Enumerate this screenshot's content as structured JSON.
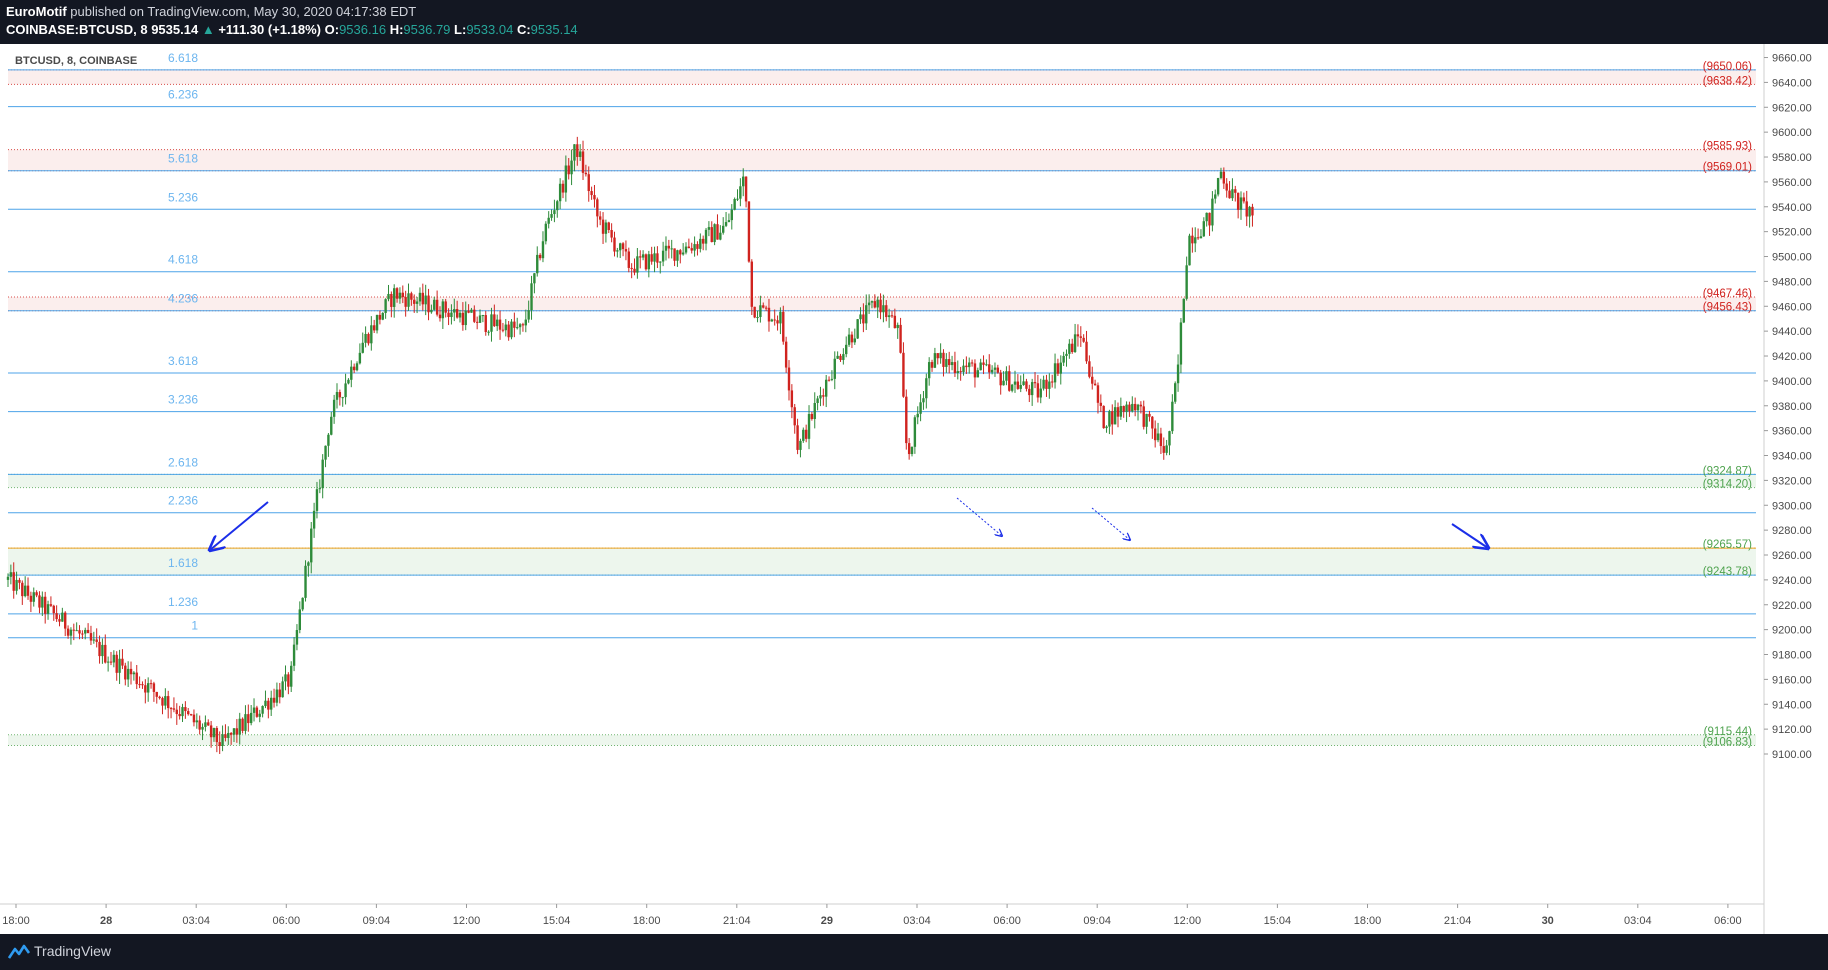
{
  "header": {
    "author": "EuroMotif",
    "published_text": "published on TradingView.com, May 30, 2020 04:17:38 EDT",
    "symbol_line": "COINBASE:BTCUSD, 8",
    "last_price": "9535.14",
    "change_arrow": "▲",
    "change": "+111.30 (+1.18%)",
    "o_label": "O:",
    "o_value": "9536.16",
    "h_label": "H:",
    "h_value": "9536.79",
    "l_label": "L:",
    "l_value": "9533.04",
    "c_label": "C:",
    "c_value": "9535.14"
  },
  "chart_title": "BTCUSD, 8, COINBASE",
  "footer": {
    "brand": "TradingView"
  },
  "colors": {
    "up": "#2e8b3a",
    "down": "#d0231f",
    "fib": "#4da3e8",
    "fib_label": "#6cb5ef",
    "resistance": "#d0231f",
    "support": "#4fa34f",
    "orange": "#f0a020",
    "arrow": "#1b2ee8"
  },
  "chart_data": {
    "type": "candlestick",
    "ylim": [
      9088,
      9670
    ],
    "y_ticks": [
      9100,
      9120,
      9140,
      9160,
      9180,
      9200,
      9220,
      9240,
      9260,
      9280,
      9300,
      9320,
      9340,
      9360,
      9380,
      9400,
      9420,
      9440,
      9460,
      9480,
      9500,
      9520,
      9540,
      9560,
      9580,
      9600,
      9620,
      9640,
      9660
    ],
    "x_ticks": [
      {
        "label": "18:00",
        "bold": false
      },
      {
        "label": "28",
        "bold": true
      },
      {
        "label": "03:04",
        "bold": false
      },
      {
        "label": "06:00",
        "bold": false
      },
      {
        "label": "09:04",
        "bold": false
      },
      {
        "label": "12:00",
        "bold": false
      },
      {
        "label": "15:04",
        "bold": false
      },
      {
        "label": "18:00",
        "bold": false
      },
      {
        "label": "21:04",
        "bold": false
      },
      {
        "label": "29",
        "bold": true
      },
      {
        "label": "03:04",
        "bold": false
      },
      {
        "label": "06:00",
        "bold": false
      },
      {
        "label": "09:04",
        "bold": false
      },
      {
        "label": "12:00",
        "bold": false
      },
      {
        "label": "15:04",
        "bold": false
      },
      {
        "label": "18:00",
        "bold": false
      },
      {
        "label": "21:04",
        "bold": false
      },
      {
        "label": "30",
        "bold": true
      },
      {
        "label": "03:04",
        "bold": false
      },
      {
        "label": "06:00",
        "bold": false
      }
    ],
    "fib_levels": [
      {
        "label": "6.618",
        "price": 9650.06
      },
      {
        "label": "6.236",
        "price": 9620.5
      },
      {
        "label": "5.618",
        "price": 9569.01
      },
      {
        "label": "5.236",
        "price": 9538.0
      },
      {
        "label": "4.618",
        "price": 9487.8
      },
      {
        "label": "4.236",
        "price": 9456.43
      },
      {
        "label": "3.618",
        "price": 9406.3
      },
      {
        "label": "3.236",
        "price": 9375.3
      },
      {
        "label": "2.618",
        "price": 9324.87
      },
      {
        "label": "2.236",
        "price": 9294.0
      },
      {
        "label": "1.618",
        "price": 9243.78
      },
      {
        "label": "1.236",
        "price": 9212.7
      },
      {
        "label": "1",
        "price": 9193.5
      }
    ],
    "zones": [
      {
        "kind": "resistance",
        "top": 9650.06,
        "bottom": 9638.42
      },
      {
        "kind": "resistance",
        "top": 9585.93,
        "bottom": 9569.01
      },
      {
        "kind": "resistance",
        "top": 9467.46,
        "bottom": 9456.43
      },
      {
        "kind": "support",
        "top": 9324.87,
        "bottom": 9314.2
      },
      {
        "kind": "support",
        "top": 9265.57,
        "bottom": 9243.78
      },
      {
        "kind": "support",
        "top": 9115.44,
        "bottom": 9106.83
      }
    ],
    "zone_labels": [
      {
        "text": "(9650.06)",
        "price": 9650.06,
        "kind": "resistance"
      },
      {
        "text": "(9638.42)",
        "price": 9638.42,
        "kind": "resistance"
      },
      {
        "text": "(9585.93)",
        "price": 9585.93,
        "kind": "resistance"
      },
      {
        "text": "(9569.01)",
        "price": 9569.01,
        "kind": "resistance"
      },
      {
        "text": "(9467.46)",
        "price": 9467.46,
        "kind": "resistance"
      },
      {
        "text": "(9456.43)",
        "price": 9456.43,
        "kind": "resistance"
      },
      {
        "text": "(9324.87)",
        "price": 9324.87,
        "kind": "support"
      },
      {
        "text": "(9314.20)",
        "price": 9314.2,
        "kind": "support"
      },
      {
        "text": "(9265.57)",
        "price": 9265.57,
        "kind": "support"
      },
      {
        "text": "(9243.78)",
        "price": 9243.78,
        "kind": "support"
      },
      {
        "text": "(9115.44)",
        "price": 9115.44,
        "kind": "support"
      },
      {
        "text": "(9106.83)",
        "price": 9106.83,
        "kind": "support"
      }
    ],
    "anchors": [
      {
        "time": "May 27 18:00",
        "price": 9240
      },
      {
        "time": "May 28 04:00",
        "price": 9108
      },
      {
        "time": "May 28 07:10",
        "price": 9160
      },
      {
        "time": "May 28 08:00",
        "price": 9262
      },
      {
        "time": "May 28 09:00",
        "price": 9370
      },
      {
        "time": "May 28 10:30",
        "price": 9430
      },
      {
        "time": "May 28 12:00",
        "price": 9470
      },
      {
        "time": "May 28 16:00",
        "price": 9448
      },
      {
        "time": "May 28 18:00",
        "price": 9440
      },
      {
        "time": "May 28 19:00",
        "price": 9520
      },
      {
        "time": "May 28 20:30",
        "price": 9588
      },
      {
        "time": "May 28 21:30",
        "price": 9530
      },
      {
        "time": "May 28 23:00",
        "price": 9492
      },
      {
        "time": "May 29 02:00",
        "price": 9510
      },
      {
        "time": "May 29 03:30",
        "price": 9525
      },
      {
        "time": "May 29 04:20",
        "price": 9565
      },
      {
        "time": "May 29 04:40",
        "price": 9460
      },
      {
        "time": "May 29 06:00",
        "price": 9450
      },
      {
        "time": "May 29 06:50",
        "price": 9345
      },
      {
        "time": "May 29 08:00",
        "price": 9395
      },
      {
        "time": "May 29 09:00",
        "price": 9430
      },
      {
        "time": "May 29 10:30",
        "price": 9465
      },
      {
        "time": "May 29 11:30",
        "price": 9440
      },
      {
        "time": "May 29 11:55",
        "price": 9337
      },
      {
        "time": "May 29 13:00",
        "price": 9418
      },
      {
        "time": "May 29 16:00",
        "price": 9405
      },
      {
        "time": "May 29 18:00",
        "price": 9390
      },
      {
        "time": "May 29 20:00",
        "price": 9438
      },
      {
        "time": "May 29 21:00",
        "price": 9368
      },
      {
        "time": "May 29 22:30",
        "price": 9383
      },
      {
        "time": "May 29 23:59",
        "price": 9342
      },
      {
        "time": "May 30 00:30",
        "price": 9405
      },
      {
        "time": "May 30 01:00",
        "price": 9515
      },
      {
        "time": "May 30 02:00",
        "price": 9530
      },
      {
        "time": "May 30 02:30",
        "price": 9570
      },
      {
        "time": "May 30 03:00",
        "price": 9550
      },
      {
        "time": "May 30 03:30",
        "price": 9540
      },
      {
        "time": "May 30 04:00",
        "price": 9535
      }
    ]
  }
}
